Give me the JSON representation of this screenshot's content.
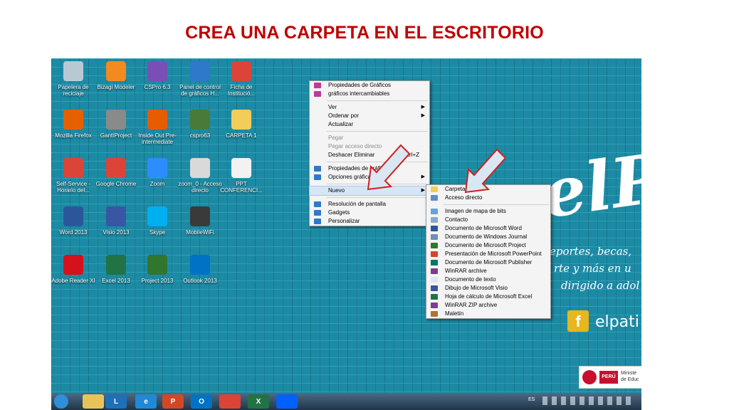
{
  "slide": {
    "title": "CREA UNA CARPETA EN EL ESCRITORIO"
  },
  "desktop_icons": [
    {
      "label": "Papelera de reciclaje",
      "icon": "recycle-bin-icon",
      "color": "#b9c9d3"
    },
    {
      "label": "Bizagi Modeler",
      "icon": "bizagi-icon",
      "color": "#f28a1e"
    },
    {
      "label": "CSPro 6.3",
      "icon": "cspro-icon",
      "color": "#7a4fb5"
    },
    {
      "label": "Panel de control de gráficos H...",
      "icon": "graphics-panel-icon",
      "color": "#2e79c9"
    },
    {
      "label": "Ficha de Institució...",
      "icon": "chrome-icon",
      "color": "#db4437"
    },
    {
      "label": "Mozilla Firefox",
      "icon": "firefox-icon",
      "color": "#e66000"
    },
    {
      "label": "GanttProject",
      "icon": "ganttproject-icon",
      "color": "#8a8a8a"
    },
    {
      "label": "Inside Out Pre-intermediate",
      "icon": "inside-out-icon",
      "color": "#e65c00"
    },
    {
      "label": "cspro63",
      "icon": "installer-icon",
      "color": "#4a7a3a"
    },
    {
      "label": "CARPETA 1",
      "icon": "folder-icon",
      "color": "#f3cd5a"
    },
    {
      "label": "Self-Service - Horario del...",
      "icon": "chrome-icon",
      "color": "#db4437"
    },
    {
      "label": "Google Chrome",
      "icon": "chrome-icon",
      "color": "#db4437"
    },
    {
      "label": "Zoom",
      "icon": "zoom-icon",
      "color": "#2d8cff"
    },
    {
      "label": "zoom_0 - Acceso directo",
      "icon": "printer-icon",
      "color": "#d9d9d9"
    },
    {
      "label": "PPT CONFERENCI...",
      "icon": "pdf-doc-icon",
      "color": "#f2f2f2"
    },
    {
      "label": "Word 2013",
      "icon": "word-icon",
      "color": "#2b579a"
    },
    {
      "label": "Visio 2013",
      "icon": "visio-icon",
      "color": "#3955a3"
    },
    {
      "label": "Skype",
      "icon": "skype-icon",
      "color": "#00aff0"
    },
    {
      "label": "MobileWiFi",
      "icon": "wifi-icon",
      "color": "#3a3a3a"
    },
    {
      "label": "Adobe Reader XI",
      "icon": "adobe-reader-icon",
      "color": "#d4121c"
    },
    {
      "label": "Excel 2013",
      "icon": "excel-icon",
      "color": "#217346"
    },
    {
      "label": "Project 2013",
      "icon": "project-icon",
      "color": "#31752f"
    },
    {
      "label": "Outlook 2013",
      "icon": "outlook-icon",
      "color": "#0072c6"
    }
  ],
  "context_menu": {
    "items": [
      {
        "label": "Propiedades de Gráficos",
        "icon": "intel-graphics-icon"
      },
      {
        "label": "gráficos intercambiables",
        "icon": "amd-icon"
      },
      {
        "label": "Ver",
        "submenu": true
      },
      {
        "label": "Ordenar por",
        "submenu": true
      },
      {
        "label": "Actualizar"
      },
      {
        "label": "Pegar",
        "disabled": true
      },
      {
        "label": "Pegar acceso directo",
        "disabled": true
      },
      {
        "label": "Deshacer Eliminar",
        "shortcut": "Ctrl+Z"
      },
      {
        "label": "Propiedades de gráficos...",
        "icon": "intel-icon"
      },
      {
        "label": "Opciones gráficas",
        "icon": "intel-icon",
        "submenu": true
      },
      {
        "label": "Nuevo",
        "submenu": true,
        "highlighted": true
      },
      {
        "label": "Resolución de pantalla",
        "icon": "display-icon"
      },
      {
        "label": "Gadgets",
        "icon": "gadgets-icon"
      },
      {
        "label": "Personalizar",
        "icon": "personalize-icon"
      }
    ]
  },
  "submenu_nuevo": {
    "items": [
      {
        "label": "Carpeta",
        "icon": "folder-icon",
        "color": "#f3cd5a"
      },
      {
        "label": "Acceso directo",
        "icon": "shortcut-icon",
        "color": "#5b8fc7"
      },
      {
        "label": "Imagen de mapa de bits",
        "icon": "bitmap-icon",
        "color": "#6aa2d8"
      },
      {
        "label": "Contacto",
        "icon": "contact-icon",
        "color": "#8aa9c7"
      },
      {
        "label": "Documento de Microsoft Word",
        "icon": "word-icon",
        "color": "#2b579a"
      },
      {
        "label": "Documento de Windows Journal",
        "icon": "journal-icon",
        "color": "#6f8fb5"
      },
      {
        "label": "Documento de Microsoft Project",
        "icon": "project-icon",
        "color": "#31752f"
      },
      {
        "label": "Presentación de Microsoft PowerPoint",
        "icon": "powerpoint-icon",
        "color": "#d24726"
      },
      {
        "label": "Documento de Microsoft Publisher",
        "icon": "publisher-icon",
        "color": "#077568"
      },
      {
        "label": "WinRAR archive",
        "icon": "winrar-icon",
        "color": "#7a3d8f"
      },
      {
        "label": "Documento de texto",
        "icon": "text-doc-icon",
        "color": "#dfe6ee"
      },
      {
        "label": "Dibujo de Microsoft Visio",
        "icon": "visio-icon",
        "color": "#3955a3"
      },
      {
        "label": "Hoja de cálculo de Microsoft Excel",
        "icon": "excel-icon",
        "color": "#217346"
      },
      {
        "label": "WinRAR ZIP archive",
        "icon": "winrar-zip-icon",
        "color": "#7a3d8f"
      },
      {
        "label": "Maletín",
        "icon": "briefcase-icon",
        "color": "#b5702c"
      }
    ]
  },
  "wallpaper": {
    "brand": "elPa",
    "promo_lines": [
      "eportes, becas,",
      "rte y más en u",
      "dirigido a adol"
    ],
    "social": "elpati",
    "footer_badge": "PERÚ",
    "footer_text": "Ministe de Educ"
  },
  "taskbar": {
    "buttons": [
      {
        "icon": "start-orb-icon",
        "color": "#2f8fd8",
        "text": ""
      },
      {
        "icon": "file-explorer-icon",
        "color": "#e7c45a",
        "text": ""
      },
      {
        "icon": "lync-icon",
        "color": "#1c6fb8",
        "text": "L"
      },
      {
        "icon": "internet-explorer-icon",
        "color": "#1e8ad6",
        "text": "e"
      },
      {
        "icon": "powerpoint-icon",
        "color": "#d24726",
        "text": "P"
      },
      {
        "icon": "outlook-icon",
        "color": "#0072c6",
        "text": "O"
      },
      {
        "icon": "chrome-icon",
        "color": "#db4437",
        "text": ""
      },
      {
        "icon": "excel-icon",
        "color": "#217346",
        "text": "X"
      },
      {
        "icon": "dropbox-icon",
        "color": "#0061fe",
        "text": ""
      }
    ],
    "language": "ES"
  }
}
